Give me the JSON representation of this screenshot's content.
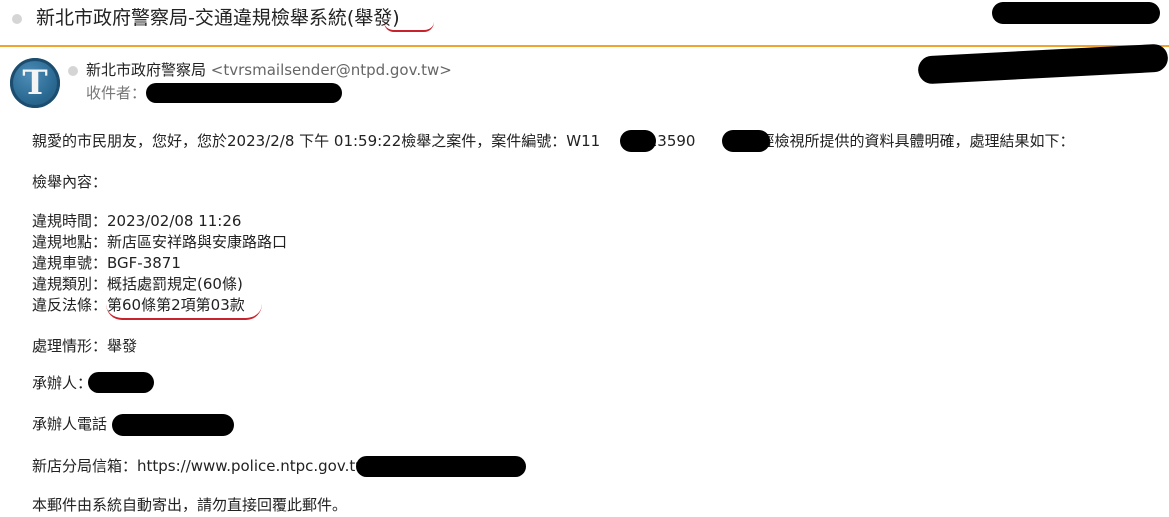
{
  "subject": {
    "title_prefix": "新北市政府警察局-交通違規檢舉系統",
    "title_status": "(舉發)"
  },
  "sender": {
    "name": "新北市政府警察局",
    "email": "<tvrsmailsender@ntpd.gov.tw>",
    "avatar_letter": "T"
  },
  "recipient": {
    "label": "收件者："
  },
  "body": {
    "greeting_start": "親愛的市民朋友，您好，您於2023/2/8 下午 01:59:22檢舉之案件，案件編號：W11",
    "greeting_mid": "813590",
    "greeting_end": "19，經檢視所提供的資料具體明確，處理結果如下：",
    "report_heading": "檢舉內容：",
    "violation_time": "違規時間：2023/02/08 11:26",
    "violation_location": "違規地點：新店區安祥路與安康路路口",
    "violation_plate": "違規車號：BGF-3871",
    "violation_category": "違規類別：概括處罰規定(60條)",
    "violation_law_label": "違反法條：",
    "violation_law_value": "第60條第2項第03款",
    "handling_status": "處理情形：舉發",
    "handler_label": "承辦人：",
    "handler_phone_label": "承辦人電話",
    "mailbox_label": "新店分局信箱：https://www.police.ntpc.gov.tw",
    "footer_note": "本郵件由系統自動寄出，請勿直接回覆此郵件。"
  },
  "colors": {
    "accent_line": "#f0a330",
    "annotation_red": "#c8232c",
    "redaction": "#000000"
  }
}
